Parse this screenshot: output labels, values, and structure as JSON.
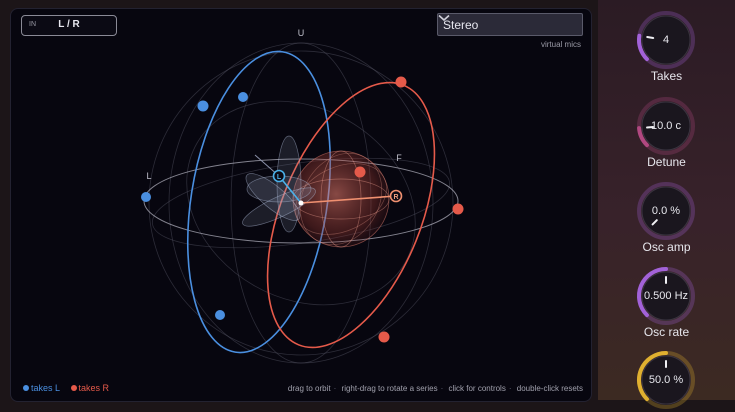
{
  "viz": {
    "in_label": "IN",
    "routing": "L / R",
    "mic_select": {
      "value": "Stereo",
      "sublabel": "virtual mics"
    },
    "axis_labels": {
      "up": "U",
      "left": "L",
      "front": "F"
    },
    "mic_markers": {
      "left": "L",
      "right": "R"
    },
    "legend": [
      {
        "label": "takes L",
        "color": "#4a8fe0"
      },
      {
        "label": "takes R",
        "color": "#e55a4a"
      }
    ],
    "hints": [
      "drag to orbit",
      "right-drag to rotate a series",
      "click for controls",
      "double-click resets"
    ]
  },
  "controls": [
    {
      "label": "Takes",
      "value": "4",
      "fraction": 0.2,
      "color": "#a262d8"
    },
    {
      "label": "Detune",
      "value": "10.0 c",
      "fraction": 0.15,
      "color": "#b04880"
    },
    {
      "label": "Osc amp",
      "value": "0.0 %",
      "fraction": 0.0,
      "color": "#a262d8"
    },
    {
      "label": "Osc rate",
      "value": "0.500 Hz",
      "fraction": 0.5,
      "color": "#a262d8"
    },
    {
      "label": "",
      "value": "50.0 %",
      "fraction": 0.5,
      "color": "#e0b030"
    }
  ],
  "colors": {
    "left": "#4a8fe0",
    "right": "#e55a4a",
    "accent": "#a262d8"
  }
}
